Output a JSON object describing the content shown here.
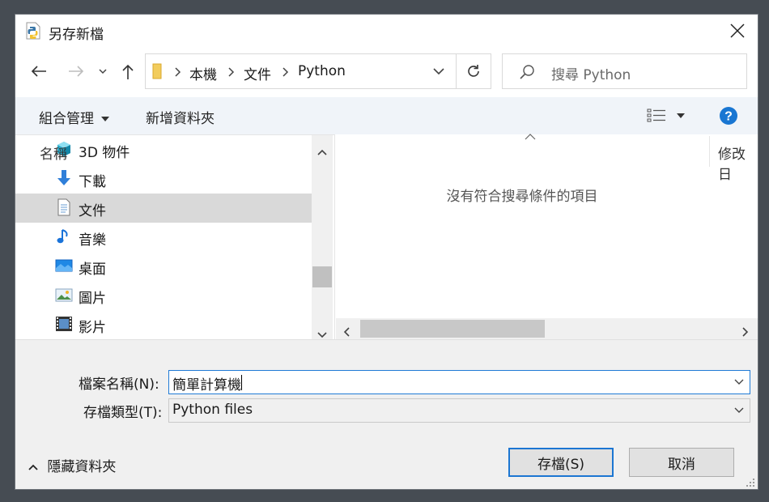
{
  "window": {
    "title": "另存新檔"
  },
  "address_bar": {
    "crumbs": [
      "本機",
      "文件",
      "Python"
    ]
  },
  "search": {
    "placeholder": "搜尋 Python"
  },
  "toolbar": {
    "organize_label": "組合管理",
    "new_folder_label": "新增資料夾"
  },
  "nav_tree": {
    "items": [
      {
        "label": "3D 物件",
        "icon": "3d-objects-icon"
      },
      {
        "label": "下載",
        "icon": "downloads-icon"
      },
      {
        "label": "文件",
        "icon": "documents-icon",
        "selected": true
      },
      {
        "label": "音樂",
        "icon": "music-icon"
      },
      {
        "label": "桌面",
        "icon": "desktop-icon"
      },
      {
        "label": "圖片",
        "icon": "pictures-icon"
      },
      {
        "label": "影片",
        "icon": "videos-icon"
      }
    ]
  },
  "file_list": {
    "columns": [
      "名稱",
      "修改日"
    ],
    "empty_message": "沒有符合搜尋條件的項目"
  },
  "form": {
    "filename_label": "檔案名稱(N):",
    "filename_value": "簡單計算機",
    "filetype_label": "存檔類型(T):",
    "filetype_value": "Python files"
  },
  "footer": {
    "hide_folders_label": "隱藏資料夾",
    "save_label": "存檔(S)",
    "cancel_label": "取消"
  },
  "colors": {
    "accent": "#1c76d2",
    "selection": "#d9d9d9",
    "toolbar_bg": "#f0f4f9",
    "help": "#1976d2"
  }
}
